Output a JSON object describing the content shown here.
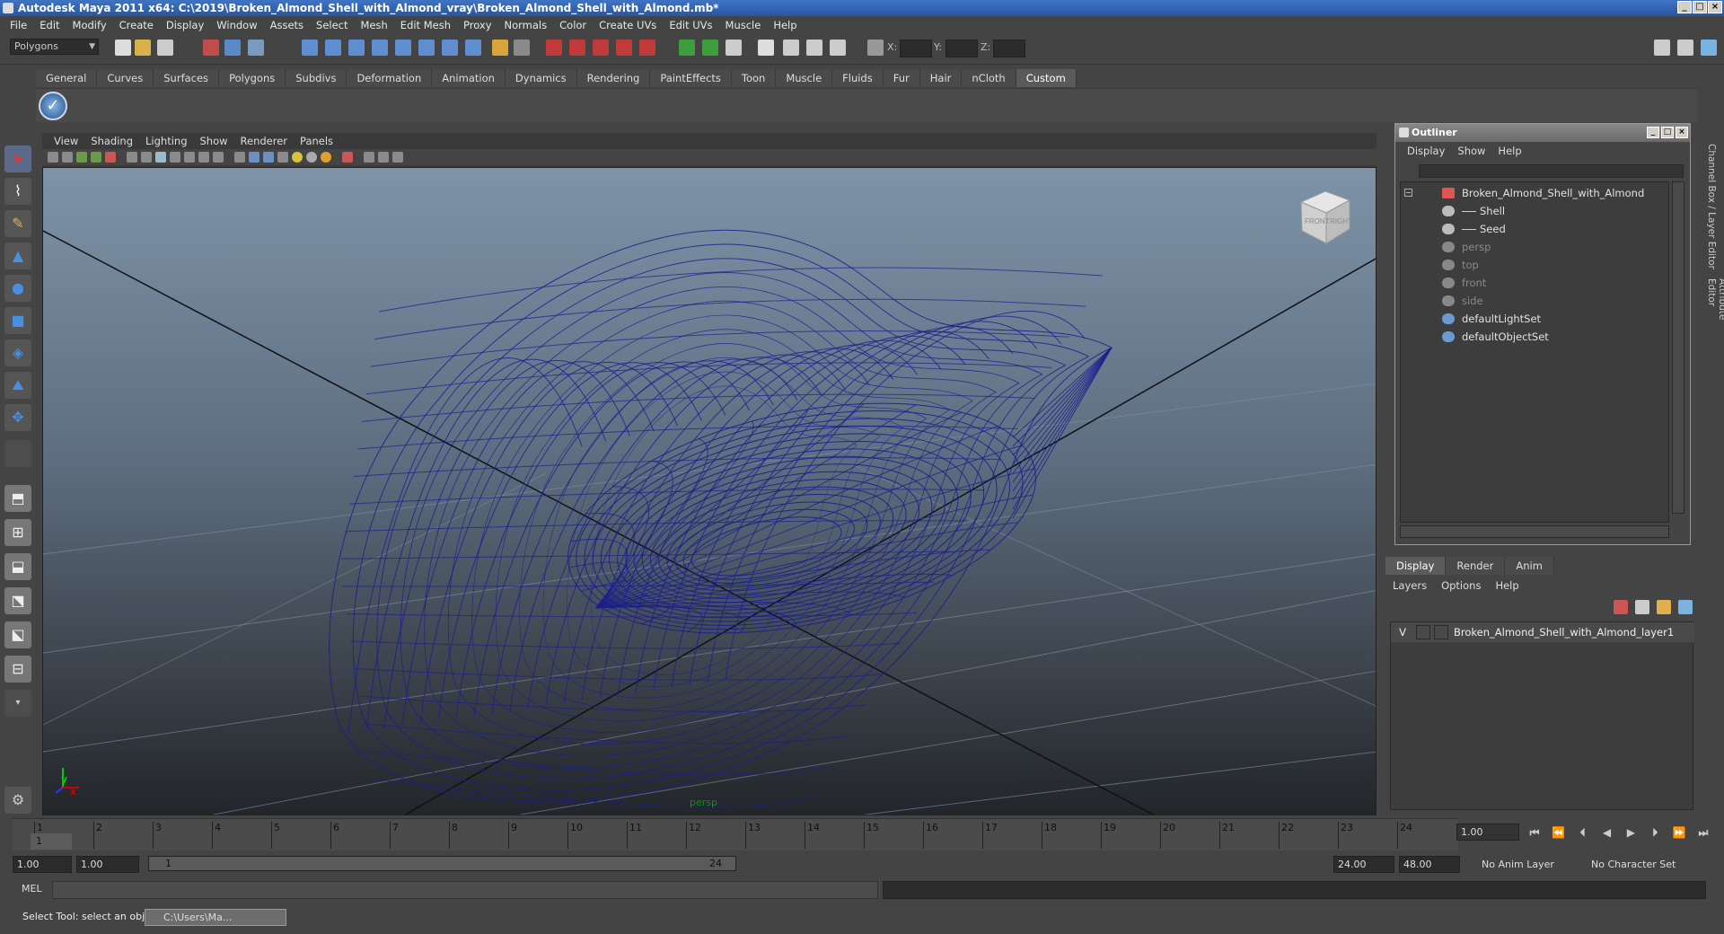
{
  "window": {
    "title": "Autodesk Maya 2011 x64: C:\\2019\\Broken_Almond_Shell_with_Almond_vray\\Broken_Almond_Shell_with_Almond.mb*"
  },
  "menubar": [
    "File",
    "Edit",
    "Modify",
    "Create",
    "Display",
    "Window",
    "Assets",
    "Select",
    "Mesh",
    "Edit Mesh",
    "Proxy",
    "Normals",
    "Color",
    "Create UVs",
    "Edit UVs",
    "Muscle",
    "Help"
  ],
  "status_line": {
    "mode": "Polygons",
    "x_label": "X:",
    "y_label": "Y:",
    "z_label": "Z:"
  },
  "shelf": {
    "tabs": [
      "General",
      "Curves",
      "Surfaces",
      "Polygons",
      "Subdivs",
      "Deformation",
      "Animation",
      "Dynamics",
      "Rendering",
      "PaintEffects",
      "Toon",
      "Muscle",
      "Fluids",
      "Fur",
      "Hair",
      "nCloth",
      "Custom"
    ],
    "active": "Custom"
  },
  "viewport": {
    "menus": [
      "View",
      "Shading",
      "Lighting",
      "Show",
      "Renderer",
      "Panels"
    ],
    "camera": "persp",
    "viewcube": {
      "front": "FRONT",
      "right": "RIGHT"
    },
    "axis": {
      "y": "y",
      "x": "x"
    },
    "wire_color": "#1a1f8c"
  },
  "outliner": {
    "title": "Outliner",
    "menus": [
      "Display",
      "Show",
      "Help"
    ],
    "items": [
      {
        "label": "Broken_Almond_Shell_with_Almond",
        "dim": false
      },
      {
        "label": "Shell",
        "dim": false
      },
      {
        "label": "Seed",
        "dim": false
      },
      {
        "label": "persp",
        "dim": true
      },
      {
        "label": "top",
        "dim": true
      },
      {
        "label": "front",
        "dim": true
      },
      {
        "label": "side",
        "dim": true
      },
      {
        "label": "defaultLightSet",
        "dim": false
      },
      {
        "label": "defaultObjectSet",
        "dim": false
      }
    ]
  },
  "side_tabs": [
    "Channel Box / Layer Editor",
    "Attribute Editor"
  ],
  "layers": {
    "tabs": [
      "Display",
      "Render",
      "Anim"
    ],
    "active_tab": "Display",
    "menus": [
      "Layers",
      "Options",
      "Help"
    ],
    "rows": [
      {
        "visible": "V",
        "name": "Broken_Almond_Shell_with_Almond_layer1"
      }
    ]
  },
  "timeline": {
    "ticks": [
      "1",
      "2",
      "3",
      "4",
      "5",
      "6",
      "7",
      "8",
      "9",
      "10",
      "11",
      "12",
      "13",
      "14",
      "15",
      "16",
      "17",
      "18",
      "19",
      "20",
      "21",
      "22",
      "23",
      "24"
    ],
    "current_frame": "1.00",
    "current_marker": "1"
  },
  "range": {
    "start": "1.00",
    "playback_start": "1.00",
    "slider_start": "1",
    "slider_end": "24",
    "playback_end": "24.00",
    "end": "48.00",
    "anim_layer": "No Anim Layer",
    "character_set": "No Character Set"
  },
  "command_line": {
    "label": "MEL"
  },
  "help_line": {
    "text": "Select Tool: select an object",
    "task_button": "C:\\Users\\Ma..."
  }
}
